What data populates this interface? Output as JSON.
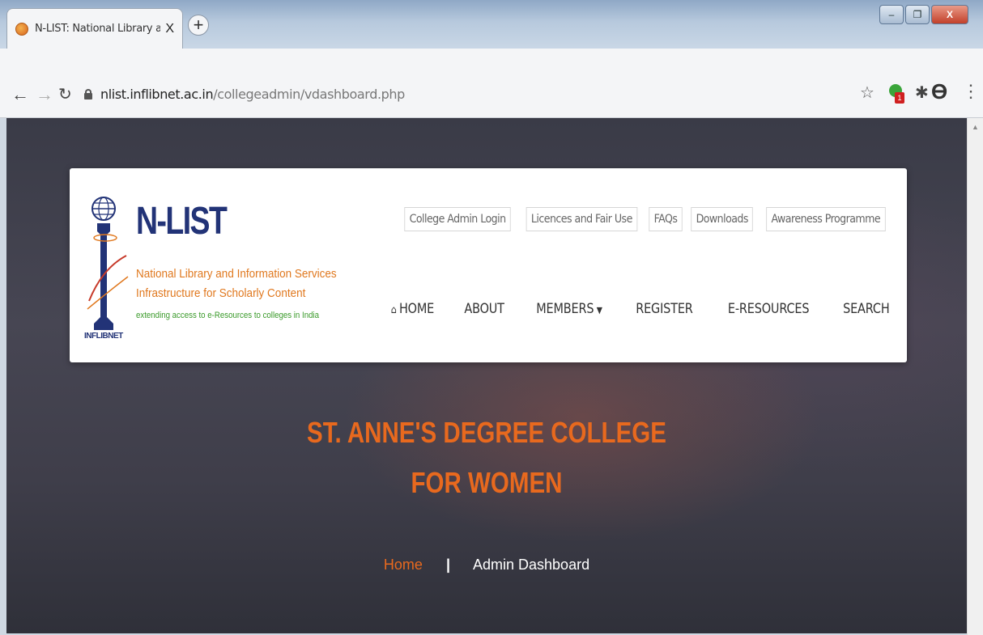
{
  "browser": {
    "tab_title": "N-LIST: National Library and Info",
    "tab_close": "X",
    "new_tab": "+",
    "url_host": "nlist.inflibnet.ac.in",
    "url_path": "/collegeadmin/vdashboard.php",
    "extension_badge": "1",
    "window_controls": {
      "minimize": "–",
      "maximize": "❐",
      "close": "X"
    }
  },
  "site": {
    "brand": {
      "title": "N-LIST",
      "line1": "National Library and Information Services",
      "line2": "Infrastructure for Scholarly Content",
      "tagline": "extending access to e-Resources to colleges in India",
      "emblem_label": "INFLIBNET"
    },
    "top_links": [
      "College Admin Login",
      "Licences and Fair Use",
      "FAQs",
      "Downloads",
      "Awareness Programme"
    ],
    "nav": {
      "home": "HOME",
      "about": "ABOUT",
      "members": "MEMBERS",
      "register": "REGISTER",
      "eresources": "E-RESOURCES",
      "search": "SEARCH"
    }
  },
  "hero": {
    "line1": "ST. ANNE'S DEGREE COLLEGE",
    "line2": "FOR WOMEN",
    "breadcrumb_home": "Home",
    "breadcrumb_sep": "|",
    "breadcrumb_current": "Admin Dashboard"
  },
  "colors": {
    "accent_orange": "#e8691e",
    "brand_navy": "#223377",
    "tagline_green": "#3a9a2a"
  }
}
